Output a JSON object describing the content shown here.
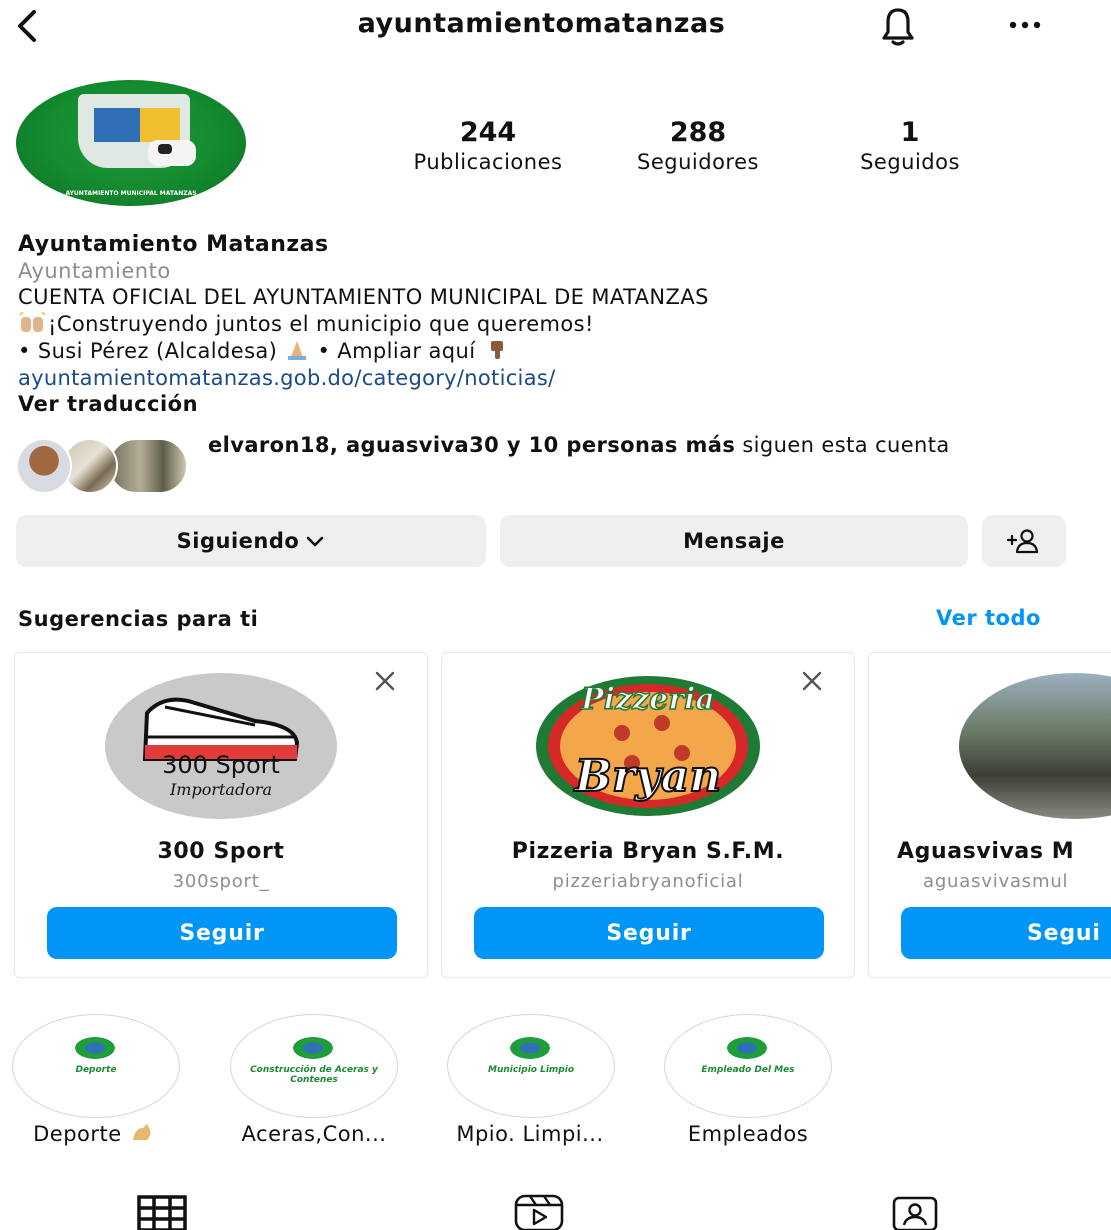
{
  "header": {
    "username": "ayuntamientomatanzas",
    "back_icon": "back-chevron-icon",
    "bell_icon": "bell-icon",
    "more_icon": "more-options-icon"
  },
  "profile": {
    "avatar_text": "AYUNTAMIENTO MUNICIPAL MATANZAS",
    "stats": [
      {
        "value": "244",
        "label": "Publicaciones"
      },
      {
        "value": "288",
        "label": "Seguidores"
      },
      {
        "value": "1",
        "label": "Seguidos"
      }
    ],
    "name": "Ayuntamiento Matanzas",
    "category": "Ayuntamiento",
    "bio_line1": "CUENTA OFICIAL DEL AYUNTAMIENTO MUNICIPAL DE MATANZAS",
    "bio_line2": "¡Construyendo juntos el municipio que queremos!",
    "bio_line3a": "• Susi Pérez (Alcaldesa)",
    "bio_line3b": "• Ampliar aquí",
    "link": "ayuntamientomatanzas.gob.do/category/noticias/",
    "translate": "Ver traducción"
  },
  "followed_by": {
    "bold_text": "elvaron18, aguasviva30 y 10 personas más",
    "rest_text": "siguen esta cuenta"
  },
  "actions": {
    "following": "Siguiendo",
    "message": "Mensaje"
  },
  "suggestions": {
    "title": "Sugerencias para ti",
    "see_all": "Ver todo",
    "cards": [
      {
        "name": "300 Sport",
        "handle": "300sport_",
        "follow": "Seguir",
        "pic_line1": "300 Sport",
        "pic_line2": "Importadora"
      },
      {
        "name": "Pizzeria Bryan S.F.M.",
        "handle": "pizzeriabryanoficial",
        "follow": "Seguir",
        "pic_line1": "Pizzeria",
        "pic_line2": "Bryan"
      },
      {
        "name": "Aguasvivas M",
        "handle": "aguasvivasmul",
        "follow": "Segui"
      }
    ]
  },
  "highlights": [
    {
      "label": "Deporte",
      "cover_text": "Deporte"
    },
    {
      "label": "Aceras,Con...",
      "cover_text": "Construcción de Aceras y Contenes"
    },
    {
      "label": "Mpio. Limpi...",
      "cover_text": "Municipio Limpio"
    },
    {
      "label": "Empleados",
      "cover_text": "Empleado Del Mes"
    }
  ],
  "tabs": [
    "grid-icon",
    "reels-icon",
    "tagged-icon"
  ],
  "colors": {
    "accent": "#0095f6",
    "link": "#1a4a8a",
    "button_bg": "#efefef"
  }
}
